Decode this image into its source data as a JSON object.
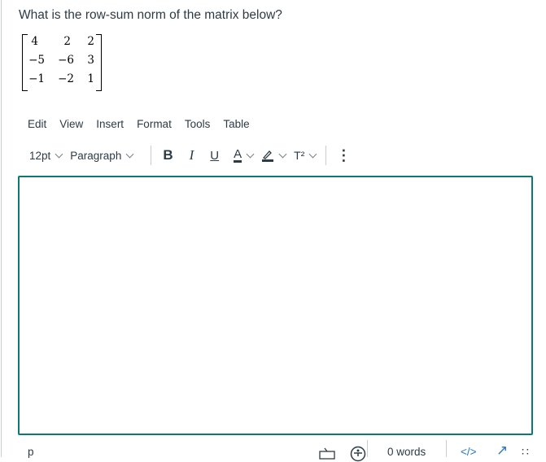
{
  "question": "What is the row-sum norm of the matrix below?",
  "matrix": {
    "rows": [
      [
        "4",
        "2",
        "2"
      ],
      [
        "−5",
        "−6",
        "3"
      ],
      [
        "−1",
        "−2",
        "1"
      ]
    ]
  },
  "menubar": {
    "items": [
      "Edit",
      "View",
      "Insert",
      "Format",
      "Tools",
      "Table"
    ]
  },
  "toolbar": {
    "font_size": "12pt",
    "block_format": "Paragraph",
    "bold_icon": "B",
    "italic_icon": "I",
    "underline_icon": "U",
    "text_color_icon": "A",
    "superscript_icon": "T²",
    "more_icon": "⋮"
  },
  "editor": {
    "content": ""
  },
  "statusbar": {
    "path": "p",
    "word_count": "0 words",
    "html_toggle": "</>",
    "fullscreen_icon": "↗",
    "resize_icon": "∷"
  },
  "colors": {
    "accent": "#0b7a75",
    "text": "#2d3b45"
  }
}
